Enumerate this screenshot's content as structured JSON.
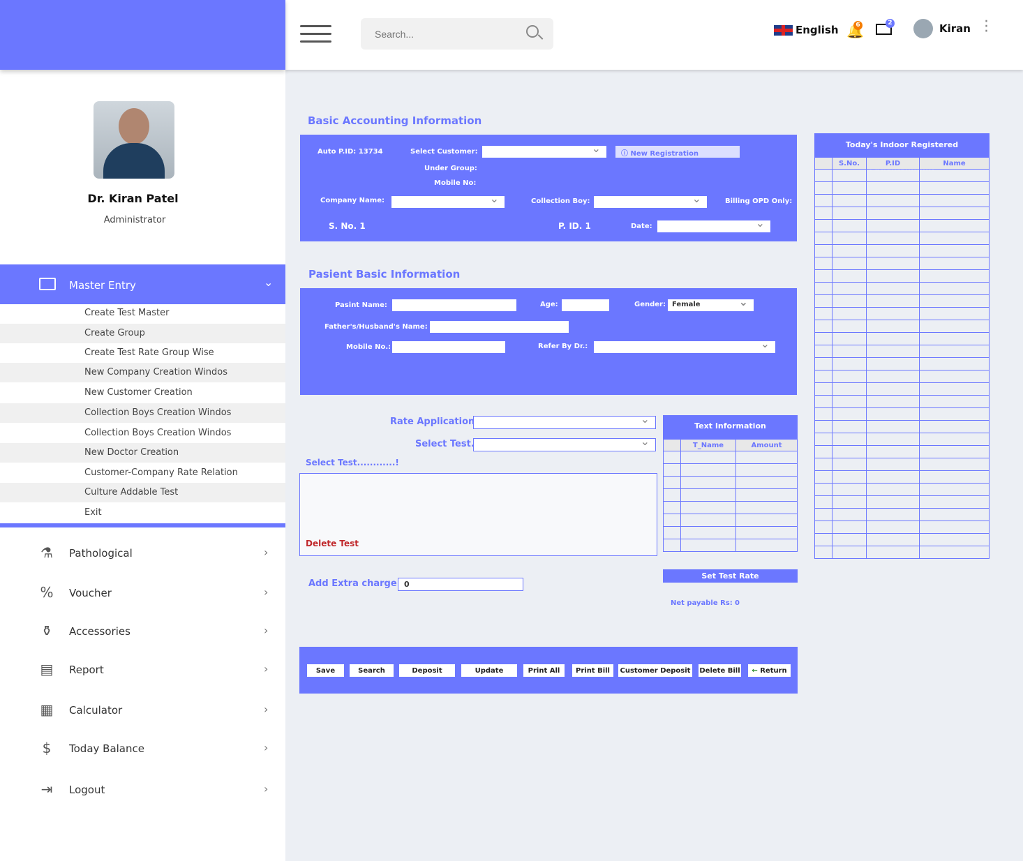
{
  "header": {
    "search_placeholder": "Search...",
    "language": "English",
    "notifications": "6",
    "messages": "2",
    "user": "Kiran"
  },
  "profile": {
    "name": "Dr. Kiran Patel",
    "role": "Administrator"
  },
  "sidebar": {
    "master": {
      "label": "Master Entry",
      "items": [
        "Create Test Master",
        "Create Group",
        "Create Test Rate Group Wise",
        "New Company Creation Windos",
        "New Customer Creation",
        "Collection Boys Creation Windos",
        "Collection Boys Creation Windos",
        "New Doctor Creation",
        "Customer-Company Rate Relation",
        "Culture Addable Test",
        "Exit"
      ]
    },
    "nav": [
      {
        "label": "Pathological",
        "icon": "microscope-icon"
      },
      {
        "label": "Voucher",
        "icon": "voucher-icon"
      },
      {
        "label": "Accessories",
        "icon": "accessories-icon"
      },
      {
        "label": "Report",
        "icon": "report-icon"
      },
      {
        "label": "Calculator",
        "icon": "calculator-icon"
      },
      {
        "label": "Today Balance",
        "icon": "balance-icon"
      },
      {
        "label": "Logout",
        "icon": "logout-icon"
      }
    ]
  },
  "accounting": {
    "title": "Basic Accounting Information",
    "auto_pid": "Auto P.ID:  13734",
    "select_customer": "Select Customer:",
    "new_registration": "New Registration",
    "under_group": "Under Group:",
    "mobile_no": "Mobile No:",
    "company_name": "Company Name:",
    "collection_boy": "Collection Boy:",
    "billing_opd": "Billing OPD Only:",
    "sno": "S. No. 1",
    "pid": "P. ID. 1",
    "date": "Date:"
  },
  "patient": {
    "title": "Pasient Basic  Information",
    "name": "Pasint Name:",
    "age": "Age:",
    "gender": "Gender:",
    "gender_value": "Female",
    "father": "Father's/Husband's Name:",
    "mobile": "Mobile No.:",
    "refer": "Refer By Dr.:"
  },
  "tests": {
    "rate_application": "Rate Application.:",
    "select_test": "Select Test.:",
    "select_test_note": "Select Test............!",
    "delete_test": "Delete  Test",
    "extra_charge": "Add Extra charge:",
    "extra_value": "0"
  },
  "text_info": {
    "title": "Text Information",
    "columns": [
      "",
      "T_Name",
      "Amount"
    ],
    "set_rate": "Set Test Rate",
    "net_payable": "Net payable Rs:",
    "net_value": "0"
  },
  "indoor": {
    "title": "Today's Indoor Registered Patients.........!",
    "columns": [
      "",
      "S.No.",
      "P.ID",
      "Name"
    ]
  },
  "actions": [
    "Save",
    "Search",
    "Deposit",
    "Update",
    "Print All",
    "Print Bill",
    "Customer Deposit",
    "Delete Bill",
    "Return"
  ],
  "colors": {
    "accent": "#6b77ff",
    "delete": "#c0282b"
  }
}
